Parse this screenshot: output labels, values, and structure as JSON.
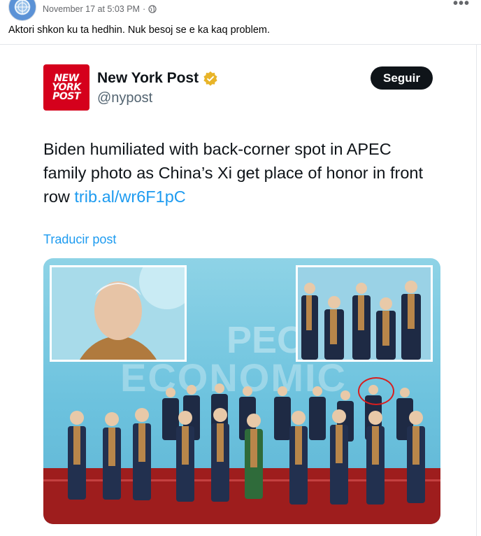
{
  "post": {
    "timestamp": "November 17 at 5:03 PM",
    "separator": "·",
    "more_label": "•••",
    "caption": "Aktori shkon ku ta hedhin. Nuk besoj se e ka kaq problem."
  },
  "tweet": {
    "logo_lines": [
      "NEW",
      "YORK",
      "POST"
    ],
    "display_name": "New York Post",
    "handle": "@nypost",
    "follow_label": "Seguir",
    "text": "Biden humiliated with back-corner spot in APEC family photo as China’s Xi get place of honor in front row ",
    "link": "trib.al/wr6F1pC",
    "translate_label": "Traducir post",
    "image": {
      "watermark_top": "PEC",
      "watermark_bottom": "ECONOMIC"
    }
  },
  "colors": {
    "brand_red": "#d5001c",
    "link_blue": "#1d9bf0",
    "verified_gold": "#e8b428",
    "highlight_red": "#d81e1e"
  }
}
